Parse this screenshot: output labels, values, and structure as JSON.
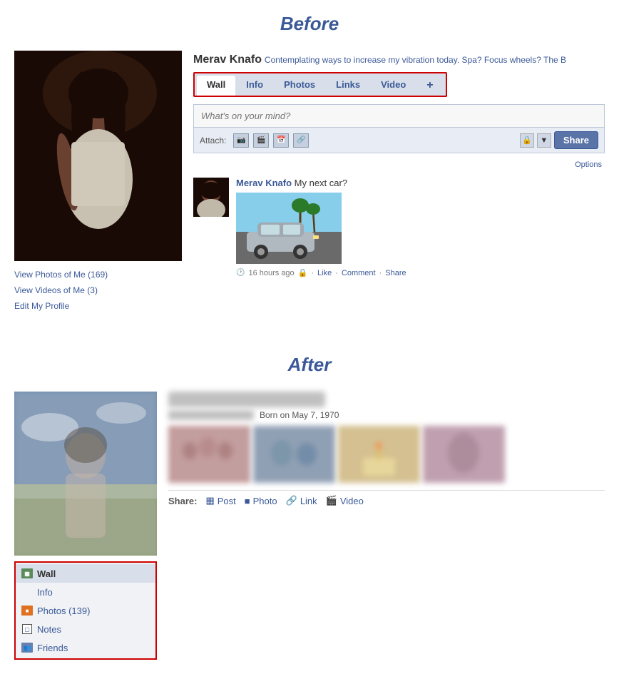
{
  "before": {
    "title": "Before",
    "profile": {
      "name": "Merav Knafo",
      "status": "Contemplating ways to increase my vibration today. Spa? Focus wheels? The B",
      "links": [
        {
          "id": "view-photos",
          "label": "View Photos of Me (169)"
        },
        {
          "id": "view-videos",
          "label": "View Videos of Me (3)"
        },
        {
          "id": "edit-profile",
          "label": "Edit My Profile"
        }
      ]
    },
    "tabs": [
      "Wall",
      "Info",
      "Photos",
      "Links",
      "Video",
      "+"
    ],
    "active_tab": "Wall",
    "wall_input_placeholder": "What's on your mind?",
    "attach_label": "Attach:",
    "share_button": "Share",
    "options_label": "Options",
    "post": {
      "author": "Merav Knafo",
      "text": "My next car?",
      "time": "16 hours ago",
      "actions": [
        "Like",
        "Comment",
        "Share"
      ]
    }
  },
  "after": {
    "title": "After",
    "sidebar_items": [
      {
        "id": "wall",
        "label": "Wall",
        "icon": "wall-icon",
        "active": true
      },
      {
        "id": "info",
        "label": "Info",
        "icon": "none"
      },
      {
        "id": "photos",
        "label": "Photos (139)",
        "icon": "photo-icon"
      },
      {
        "id": "notes",
        "label": "Notes",
        "icon": "notes-icon"
      },
      {
        "id": "friends",
        "label": "Friends",
        "icon": "friends-icon"
      }
    ],
    "born_label": "Born on May 7, 1970",
    "share_label": "Share:",
    "share_actions": [
      "Post",
      "Photo",
      "Link",
      "Video"
    ]
  }
}
